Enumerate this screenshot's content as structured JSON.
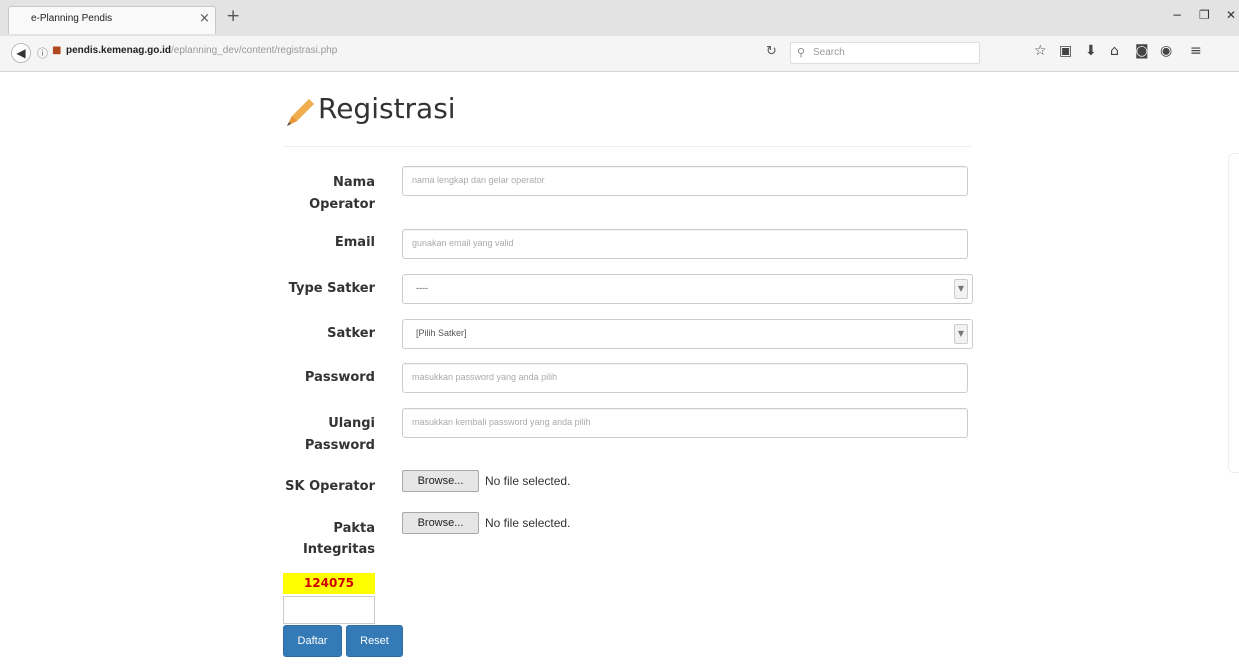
{
  "browser": {
    "tab_title": "e-Planning Pendis",
    "tab_close": "×",
    "new_tab": "+",
    "url_domain": "pendis.kemenag.go.id",
    "url_path": "/eplanning_dev/content/registrasi.php",
    "search_placeholder": "Search",
    "minimize": "−",
    "restore": "❐",
    "close": "✕"
  },
  "page": {
    "title": "Registrasi",
    "accent_color": "#f0ad4e"
  },
  "form": {
    "nama_operator_label_1": "Nama",
    "nama_operator_label_2": "Operator",
    "nama_operator_placeholder": "nama lengkap dan gelar operator",
    "email_label": "Email",
    "email_placeholder": "gunakan email yang valid",
    "type_satker_label": "Type Satker",
    "type_satker_value": "----",
    "satker_label": "Satker",
    "satker_value": "[Pilih Satker]",
    "password_label": "Password",
    "password_placeholder": "masukkan password yang anda pilih",
    "ulangi_password_label_1": "Ulangi",
    "ulangi_password_label_2": "Password",
    "ulangi_password_placeholder": "masukkan kembali password yang anda pilih",
    "sk_operator_label": "SK Operator",
    "pakta_label_1": "Pakta",
    "pakta_label_2": "Integritas",
    "browse_label": "Browse...",
    "no_file_text": "No file selected.",
    "captcha_code": "124075",
    "submit_label": "Daftar",
    "reset_label": "Reset"
  }
}
